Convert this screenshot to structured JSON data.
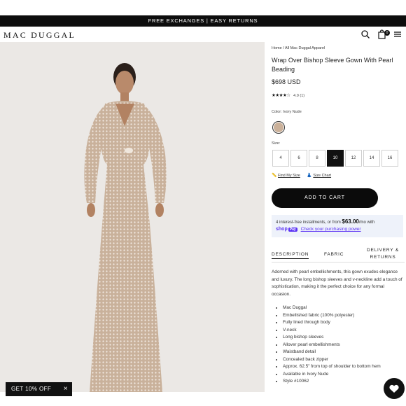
{
  "announcement": "FREE EXCHANGES | EASY RETURNS",
  "header": {
    "logo": "MAC DUGGAL",
    "cart_count": "0",
    "icons": [
      "search-icon",
      "bag-icon",
      "menu-icon"
    ]
  },
  "promo": {
    "label": "GET 10% OFF",
    "close": "×"
  },
  "product": {
    "breadcrumb": "Home / All Mac Duggal Apparel",
    "title": "Wrap Over Bishop Sleeve Gown With Pearl Beading",
    "price": "$698 USD",
    "rating": {
      "stars": "★★★★☆",
      "score": "4.0",
      "count": "(1)",
      "value": 4.0
    },
    "color_label": "Color: Ivory Nude",
    "swatch_color": "#cbb19a",
    "size_label": "Size:",
    "sizes": [
      "4",
      "6",
      "8",
      "10",
      "12",
      "14",
      "16"
    ],
    "selected_size": "10",
    "find_size": "Find My Size",
    "size_chart": "Size Chart",
    "add_to_cart": "ADD TO CART",
    "installments_prefix": "4 interest-free installments, or from",
    "installments_amount": "$63.00",
    "installments_suffix": "/mo with",
    "shop_pay_brand": "shop",
    "shop_pay_pay": "Pay",
    "check_power": "Check your purchasing power",
    "tabs": {
      "description": "DESCRIPTION",
      "fabric": "FABRIC",
      "delivery": "DELIVERY &",
      "returns": "RETURNS"
    },
    "description": "Adorned with pearl embellishments, this gown exudes elegance and luxury. The long bishop sleeves and v-neckline add a touch of sophistication, making it the perfect choice for any formal occasion.",
    "features": [
      "Mac Duggal",
      "Embellished fabric (100% polyester)",
      "Fully lined through body",
      "V-neck",
      "Long bishop sleeves",
      "Allover pearl embellishments",
      "Waistband detail",
      "Concealed back zipper",
      "Approx. 62.5\" from top of shoulder to bottom hem",
      "Available in Ivory Nude",
      "Style #10062"
    ]
  }
}
